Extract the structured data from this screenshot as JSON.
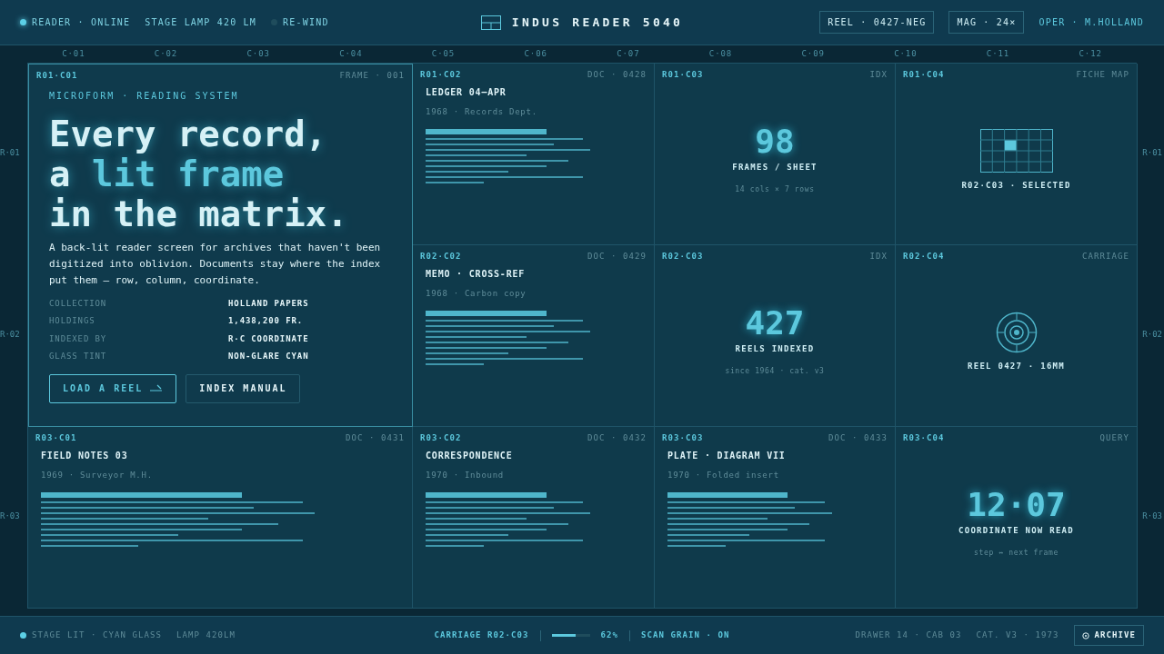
{
  "top_bar": {
    "status": [
      {
        "label": "READER · ONLINE",
        "on": true
      },
      {
        "label": "STAGE LAMP 420 LM"
      },
      {
        "label": "RE-WIND",
        "on": false
      }
    ],
    "title": "INDUS READER 5040",
    "chips": [
      "REEL · 0427-NEG",
      "MAG · 24×"
    ],
    "operator": "OPER · M.HOLLAND"
  },
  "columns": [
    "C·01",
    "C·02",
    "C·03",
    "C·04",
    "C·05",
    "C·06",
    "C·07",
    "C·08",
    "C·09",
    "C·10",
    "C·11",
    "C·12"
  ],
  "rows_left": [
    "R·01",
    "R·02",
    "R·03"
  ],
  "rows_right": [
    "R·01",
    "R·02",
    "R·03"
  ],
  "hero": {
    "coord": "R01·C01",
    "tag": "FRAME · 001",
    "eyebrow": "MICROFORM · READING SYSTEM",
    "headline": [
      "Every record,",
      "a ",
      "lit frame",
      "in the matrix."
    ],
    "body": "A back-lit reader screen for archives that haven't been digitized into oblivion. Documents stay where the index put them — row, column, coordinate.",
    "specs": [
      {
        "label": "COLLECTION",
        "value": "HOLLAND PAPERS"
      },
      {
        "label": "HOLDINGS",
        "value": "1,438,200 FR."
      },
      {
        "label": "INDEXED BY",
        "value": "R·C COORDINATE"
      },
      {
        "label": "GLASS TINT",
        "value": "NON-GLARE CYAN"
      }
    ],
    "buttons": [
      {
        "label": "LOAD A REEL",
        "primary": true
      },
      {
        "label": "INDEX MANUAL",
        "primary": false
      }
    ]
  },
  "cells": [
    {
      "kind": "doc",
      "coord": "R01·C02",
      "tag": "DOC · 0428",
      "title": "LEDGER 04—APR",
      "sub": "1968 · Records Dept."
    },
    {
      "kind": "stat",
      "coord": "R01·C03",
      "tag": "IDX",
      "value": "98",
      "label": "FRAMES / SHEET",
      "sub": "14 cols × 7 rows"
    },
    {
      "kind": "fiche",
      "coord": "R01·C04",
      "tag": "FICHE MAP",
      "label": "R02·C03 · SELECTED"
    },
    {
      "kind": "doc",
      "coord": "R02·C02",
      "tag": "DOC · 0429",
      "title": "MEMO · CROSS-REF",
      "sub": "1968 · Carbon copy"
    },
    {
      "kind": "stat",
      "coord": "R02·C03",
      "tag": "IDX",
      "value": "427",
      "label": "REELS INDEXED",
      "sub": "since 1964 · cat. v3"
    },
    {
      "kind": "reel",
      "coord": "R02·C04",
      "tag": "CARRIAGE",
      "label": "REEL 0427 · 16MM"
    },
    {
      "kind": "doc",
      "coord": "R03·C01",
      "tag": "DOC · 0431",
      "title": "FIELD NOTES 03",
      "sub": "1969 · Surveyor M.H."
    },
    {
      "kind": "doc",
      "coord": "R03·C02",
      "tag": "DOC · 0432",
      "title": "CORRESPONDENCE",
      "sub": "1970 · Inbound"
    },
    {
      "kind": "doc",
      "coord": "R03·C03",
      "tag": "DOC · 0433",
      "title": "PLATE · DIAGRAM VII",
      "sub": "1970 · Folded insert"
    },
    {
      "kind": "stat",
      "coord": "R03·C04",
      "tag": "QUERY",
      "value": "12·07",
      "label": "COORDINATE NOW READ",
      "sub": "step ↔ next frame"
    }
  ],
  "status_bar": {
    "left": [
      "STAGE LIT · CYAN GLASS",
      "LAMP 420LM"
    ],
    "carriage": "CARRIAGE R02·C03",
    "level": 0.62,
    "reading": "62%",
    "grain": "SCAN GRAIN · ON",
    "right": [
      "DRAWER 14 · CAB 03",
      "CAT. V3 · 1973"
    ],
    "button": "ARCHIVE"
  }
}
